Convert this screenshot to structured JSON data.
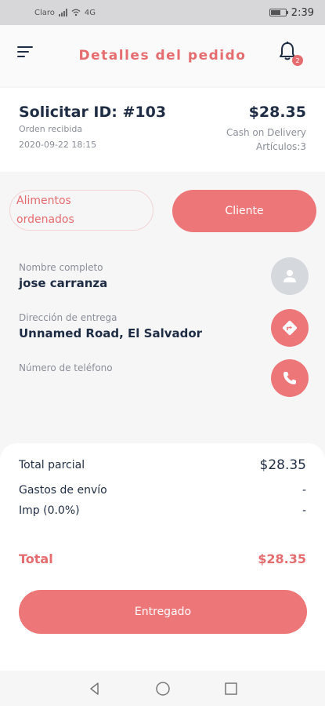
{
  "status_bar": {
    "carrier": "Claro",
    "network": "4G",
    "battery_label": "battery-icon",
    "battery_level": 0.7,
    "time": "2:39"
  },
  "header": {
    "title": "Detalles del pedido",
    "notification_count": "2"
  },
  "order": {
    "request_id": "Solicitar ID: #103",
    "status": "Orden recibida",
    "datetime": "2020-09-22 18:15",
    "amount": "$28.35",
    "payment_method": "Cash on Delivery",
    "items": "Artículos:3"
  },
  "tabs": {
    "food_label": "Alimentos ordenados",
    "client_label": "Cliente"
  },
  "client": {
    "name_label": "Nombre completo",
    "name_value": "jose carranza",
    "address_label": "Dirección de entrega",
    "address_value": "Unnamed Road, El Salvador",
    "phone_label": "Número de teléfono",
    "phone_value": ""
  },
  "summary": {
    "subtotal_label": "Total parcial",
    "subtotal_value": "$28.35",
    "shipping_label": "Gastos de envío",
    "shipping_value": "-",
    "tax_label": "Imp (0.0%)",
    "tax_value": "-",
    "total_label": "Total",
    "total_value": "$28.35",
    "deliver_button": "Entregado"
  },
  "colors": {
    "accent": "#ED7678",
    "text_dark": "#1F2D44",
    "muted": "#8A8E98",
    "avatar_bg": "#D5D8DD"
  },
  "icons": [
    "menu-icon",
    "bell-icon",
    "user-icon",
    "directions-icon",
    "phone-icon",
    "back-nav-icon",
    "home-nav-icon",
    "recents-nav-icon"
  ]
}
